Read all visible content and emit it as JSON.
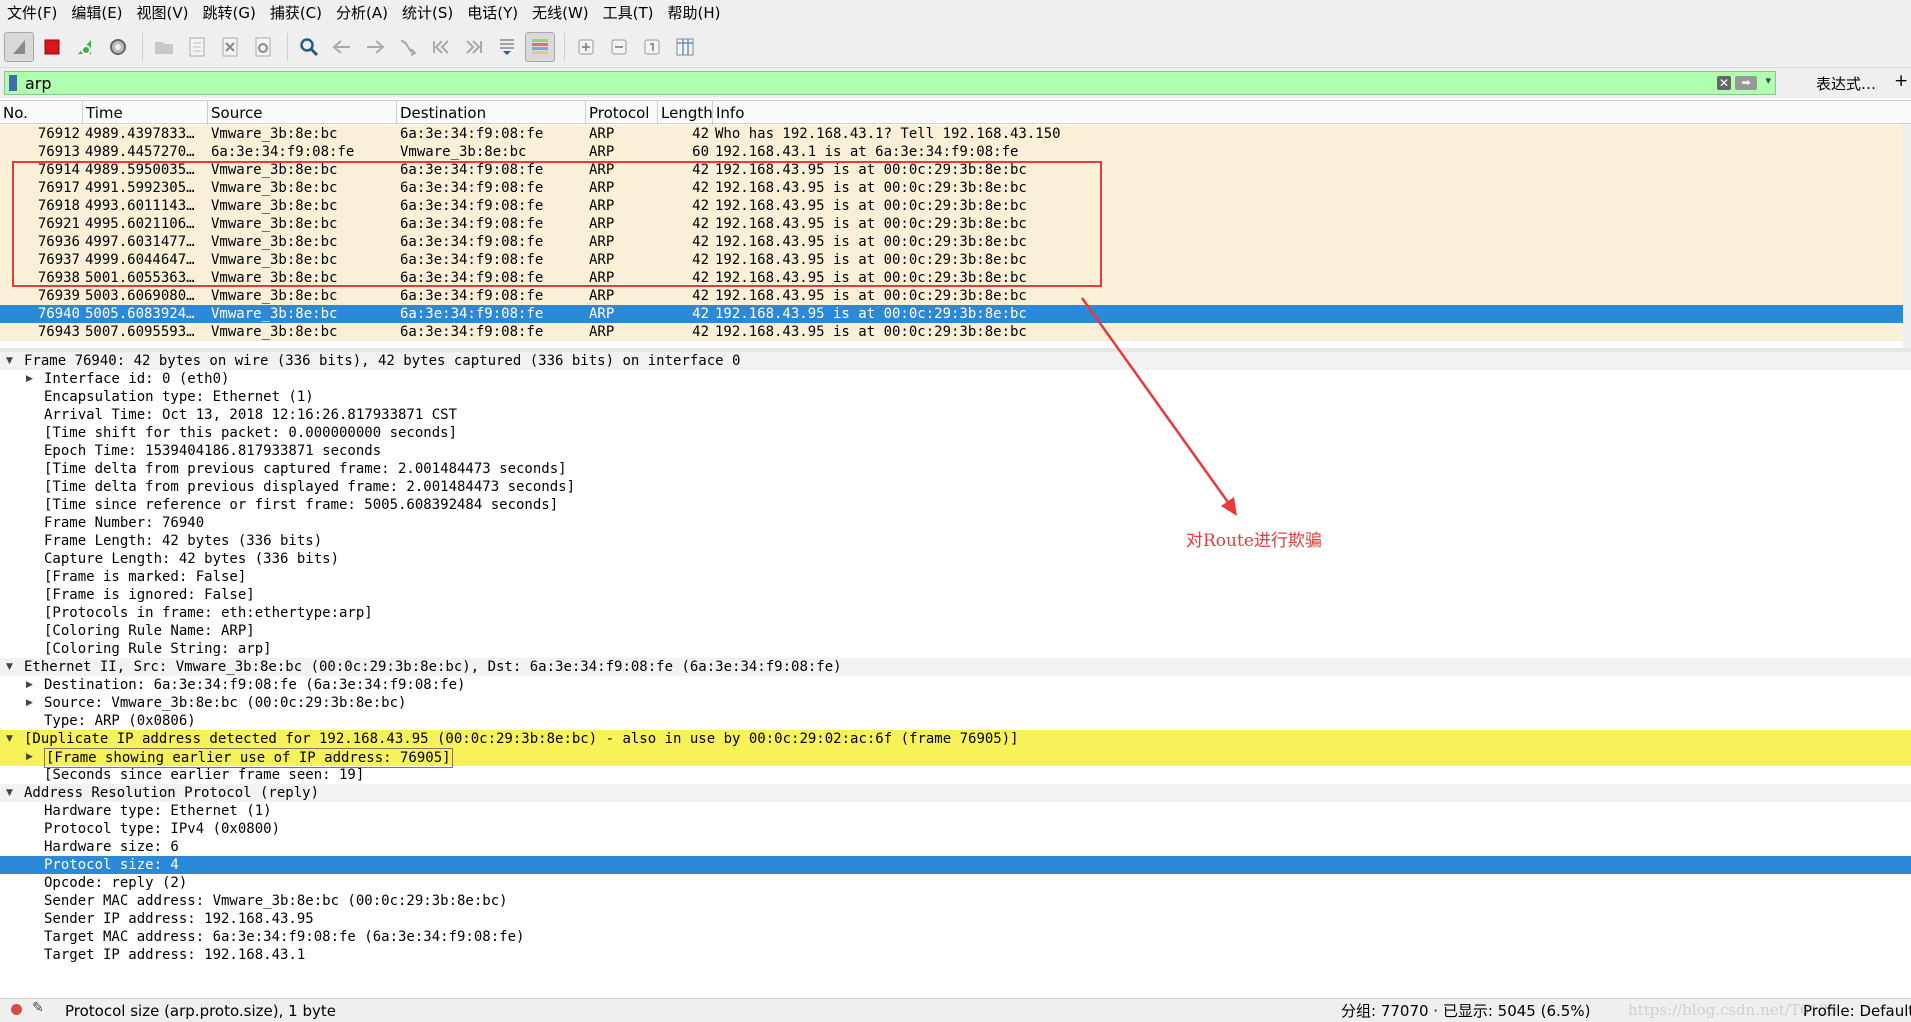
{
  "menu": [
    "文件(F)",
    "编辑(E)",
    "视图(V)",
    "跳转(G)",
    "捕获(C)",
    "分析(A)",
    "统计(S)",
    "电话(Y)",
    "无线(W)",
    "工具(T)",
    "帮助(H)"
  ],
  "toolbar": {
    "icons": [
      "shark-fin-start-icon",
      "stop-capture-icon",
      "restart-capture-icon",
      "capture-options-gear-icon",
      "open-folder-icon",
      "save-file-icon",
      "close-file-icon",
      "reload-icon",
      "find-packet-icon",
      "go-back-icon",
      "go-forward-icon",
      "go-to-packet-icon",
      "first-packet-icon",
      "last-packet-icon",
      "autoscroll-icon",
      "colorize-icon",
      "zoom-in-icon",
      "zoom-out-icon",
      "normal-size-icon",
      "resize-columns-icon"
    ]
  },
  "filter": {
    "value": "arp",
    "expression_label": "表达式…",
    "plus_label": "+"
  },
  "packet_list": {
    "columns": [
      "No.",
      "Time",
      "Source",
      "Destination",
      "Protocol",
      "Length",
      "Info"
    ],
    "rows": [
      {
        "no": "76912",
        "time": "4989.4397833…",
        "src": "Vmware_3b:8e:bc",
        "dst": "6a:3e:34:f9:08:fe",
        "proto": "ARP",
        "len": "42",
        "info": "Who has 192.168.43.1? Tell 192.168.43.150"
      },
      {
        "no": "76913",
        "time": "4989.4457270…",
        "src": "6a:3e:34:f9:08:fe",
        "dst": "Vmware_3b:8e:bc",
        "proto": "ARP",
        "len": "60",
        "info": "192.168.43.1 is at 6a:3e:34:f9:08:fe"
      },
      {
        "no": "76914",
        "time": "4989.5950035…",
        "src": "Vmware_3b:8e:bc",
        "dst": "6a:3e:34:f9:08:fe",
        "proto": "ARP",
        "len": "42",
        "info": "192.168.43.95 is at 00:0c:29:3b:8e:bc"
      },
      {
        "no": "76917",
        "time": "4991.5992305…",
        "src": "Vmware_3b:8e:bc",
        "dst": "6a:3e:34:f9:08:fe",
        "proto": "ARP",
        "len": "42",
        "info": "192.168.43.95 is at 00:0c:29:3b:8e:bc"
      },
      {
        "no": "76918",
        "time": "4993.6011143…",
        "src": "Vmware_3b:8e:bc",
        "dst": "6a:3e:34:f9:08:fe",
        "proto": "ARP",
        "len": "42",
        "info": "192.168.43.95 is at 00:0c:29:3b:8e:bc"
      },
      {
        "no": "76921",
        "time": "4995.6021106…",
        "src": "Vmware_3b:8e:bc",
        "dst": "6a:3e:34:f9:08:fe",
        "proto": "ARP",
        "len": "42",
        "info": "192.168.43.95 is at 00:0c:29:3b:8e:bc"
      },
      {
        "no": "76936",
        "time": "4997.6031477…",
        "src": "Vmware_3b:8e:bc",
        "dst": "6a:3e:34:f9:08:fe",
        "proto": "ARP",
        "len": "42",
        "info": "192.168.43.95 is at 00:0c:29:3b:8e:bc"
      },
      {
        "no": "76937",
        "time": "4999.6044647…",
        "src": "Vmware_3b:8e:bc",
        "dst": "6a:3e:34:f9:08:fe",
        "proto": "ARP",
        "len": "42",
        "info": "192.168.43.95 is at 00:0c:29:3b:8e:bc"
      },
      {
        "no": "76938",
        "time": "5001.6055363…",
        "src": "Vmware_3b:8e:bc",
        "dst": "6a:3e:34:f9:08:fe",
        "proto": "ARP",
        "len": "42",
        "info": "192.168.43.95 is at 00:0c:29:3b:8e:bc"
      },
      {
        "no": "76939",
        "time": "5003.6069080…",
        "src": "Vmware_3b:8e:bc",
        "dst": "6a:3e:34:f9:08:fe",
        "proto": "ARP",
        "len": "42",
        "info": "192.168.43.95 is at 00:0c:29:3b:8e:bc"
      },
      {
        "no": "76940",
        "time": "5005.6083924…",
        "src": "Vmware_3b:8e:bc",
        "dst": "6a:3e:34:f9:08:fe",
        "proto": "ARP",
        "len": "42",
        "info": "192.168.43.95 is at 00:0c:29:3b:8e:bc",
        "selected": true
      },
      {
        "no": "76943",
        "time": "5007.6095593…",
        "src": "Vmware_3b:8e:bc",
        "dst": "6a:3e:34:f9:08:fe",
        "proto": "ARP",
        "len": "42",
        "info": "192.168.43.95 is at 00:0c:29:3b:8e:bc"
      }
    ]
  },
  "details": [
    {
      "arrow": "expanded",
      "indent": 0,
      "text": "Frame 76940: 42 bytes on wire (336 bits), 42 bytes captured (336 bits) on interface 0",
      "style": "section"
    },
    {
      "arrow": "collapsed",
      "indent": 1,
      "text": "Interface id: 0 (eth0)"
    },
    {
      "arrow": "",
      "indent": 1,
      "text": "Encapsulation type: Ethernet (1)"
    },
    {
      "arrow": "",
      "indent": 1,
      "text": "Arrival Time: Oct 13, 2018 12:16:26.817933871 CST"
    },
    {
      "arrow": "",
      "indent": 1,
      "text": "[Time shift for this packet: 0.000000000 seconds]"
    },
    {
      "arrow": "",
      "indent": 1,
      "text": "Epoch Time: 1539404186.817933871 seconds"
    },
    {
      "arrow": "",
      "indent": 1,
      "text": "[Time delta from previous captured frame: 2.001484473 seconds]"
    },
    {
      "arrow": "",
      "indent": 1,
      "text": "[Time delta from previous displayed frame: 2.001484473 seconds]"
    },
    {
      "arrow": "",
      "indent": 1,
      "text": "[Time since reference or first frame: 5005.608392484 seconds]"
    },
    {
      "arrow": "",
      "indent": 1,
      "text": "Frame Number: 76940"
    },
    {
      "arrow": "",
      "indent": 1,
      "text": "Frame Length: 42 bytes (336 bits)"
    },
    {
      "arrow": "",
      "indent": 1,
      "text": "Capture Length: 42 bytes (336 bits)"
    },
    {
      "arrow": "",
      "indent": 1,
      "text": "[Frame is marked: False]"
    },
    {
      "arrow": "",
      "indent": 1,
      "text": "[Frame is ignored: False]"
    },
    {
      "arrow": "",
      "indent": 1,
      "text": "[Protocols in frame: eth:ethertype:arp]"
    },
    {
      "arrow": "",
      "indent": 1,
      "text": "[Coloring Rule Name: ARP]"
    },
    {
      "arrow": "",
      "indent": 1,
      "text": "[Coloring Rule String: arp]"
    },
    {
      "arrow": "expanded",
      "indent": 0,
      "text": "Ethernet II, Src: Vmware_3b:8e:bc (00:0c:29:3b:8e:bc), Dst: 6a:3e:34:f9:08:fe (6a:3e:34:f9:08:fe)",
      "style": "section"
    },
    {
      "arrow": "collapsed",
      "indent": 1,
      "text": "Destination: 6a:3e:34:f9:08:fe (6a:3e:34:f9:08:fe)"
    },
    {
      "arrow": "collapsed",
      "indent": 1,
      "text": "Source: Vmware_3b:8e:bc (00:0c:29:3b:8e:bc)"
    },
    {
      "arrow": "",
      "indent": 1,
      "text": "Type: ARP (0x0806)"
    },
    {
      "arrow": "expanded",
      "indent": 0,
      "text": "[Duplicate IP address detected for 192.168.43.95 (00:0c:29:3b:8e:bc) - also in use by 00:0c:29:02:ac:6f (frame 76905)]",
      "style": "yellow"
    },
    {
      "arrow": "collapsed",
      "indent": 1,
      "text": "[Frame showing earlier use of IP address: 76905]",
      "style": "yellow",
      "boxed": true
    },
    {
      "arrow": "",
      "indent": 1,
      "text": "[Seconds since earlier frame seen: 19]"
    },
    {
      "arrow": "expanded",
      "indent": 0,
      "text": "Address Resolution Protocol (reply)",
      "style": "section"
    },
    {
      "arrow": "",
      "indent": 1,
      "text": "Hardware type: Ethernet (1)"
    },
    {
      "arrow": "",
      "indent": 1,
      "text": "Protocol type: IPv4 (0x0800)"
    },
    {
      "arrow": "",
      "indent": 1,
      "text": "Hardware size: 6"
    },
    {
      "arrow": "",
      "indent": 1,
      "text": "Protocol size: 4",
      "style": "sel"
    },
    {
      "arrow": "",
      "indent": 1,
      "text": "Opcode: reply (2)"
    },
    {
      "arrow": "",
      "indent": 1,
      "text": "Sender MAC address: Vmware_3b:8e:bc (00:0c:29:3b:8e:bc)"
    },
    {
      "arrow": "",
      "indent": 1,
      "text": "Sender IP address: 192.168.43.95"
    },
    {
      "arrow": "",
      "indent": 1,
      "text": "Target MAC address: 6a:3e:34:f9:08:fe (6a:3e:34:f9:08:fe)"
    },
    {
      "arrow": "",
      "indent": 1,
      "text": "Target IP address: 192.168.43.1"
    }
  ],
  "annotation": {
    "text": "对Route进行欺骗",
    "color": "#e63b3b"
  },
  "status": {
    "field_info": "Protocol size (arp.proto.size), 1 byte",
    "packets": "分组: 77070 · 已显示: 5045 (6.5%)",
    "watermark": "https://blog.csdn.net/T6125",
    "profile": "Profile: Default"
  },
  "colors": {
    "arp_row_bg": "#faf0d7",
    "selection": "#2c89d8",
    "filter_valid": "#afffaf",
    "expert_warning": "#f7f25a",
    "annotation_red": "#e63b3b"
  }
}
